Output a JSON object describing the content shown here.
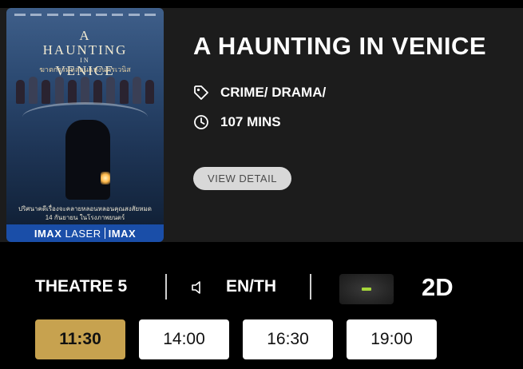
{
  "movie": {
    "title": "A HAUNTING IN VENICE",
    "genre": "CRIME/ DRAMA/",
    "duration": "107 MINS",
    "view_detail_label": "VIEW DETAIL",
    "poster": {
      "title_line1": "A",
      "title_line2": "HAUNTING",
      "title_line3": "IN",
      "title_line4": "VENICE",
      "thai_title": "ฆาตกรรมหลอนแห่งนครเวนิส",
      "tagline": "ปริศนาคดีเรื่องจะคลายหลอนหลอนคุณสงสัยหมด",
      "release": "14 กันยายน ในโรงภาพยนตร์",
      "imax_left": "IMAX",
      "imax_middle": "LASER",
      "imax_right": "IMAX"
    }
  },
  "session": {
    "theatre": "THEATRE 5",
    "audio": "EN/TH",
    "format_icon": "minus-badge",
    "format_icon_color": "#a5d63a",
    "format": "2D"
  },
  "showtimes": [
    {
      "time": "11:30",
      "selected": true
    },
    {
      "time": "14:00",
      "selected": false
    },
    {
      "time": "16:30",
      "selected": false
    },
    {
      "time": "19:00",
      "selected": false
    }
  ],
  "colors": {
    "background": "#000000",
    "card": "#1c1c1c",
    "selected_showtime": "#c7a24f",
    "view_detail_bg": "#d8d8d8"
  }
}
